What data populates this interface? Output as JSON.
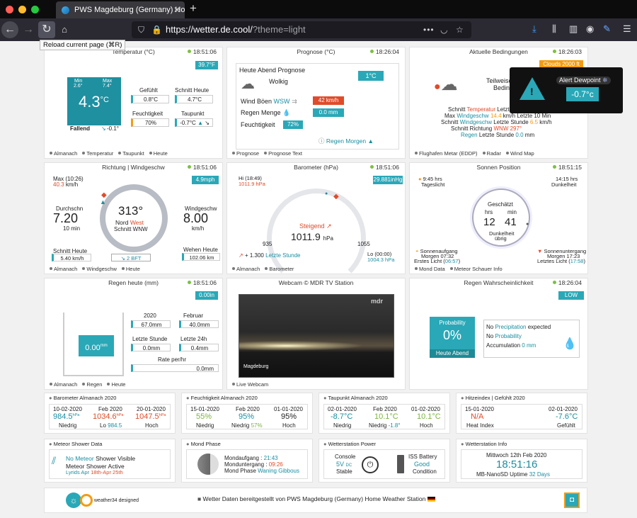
{
  "browser": {
    "tab_title": "PWS Magdeburg (Germany) Ho",
    "url_host": "https://wetter.de.cool/",
    "url_query": "?theme=light",
    "tooltip": "Reload current page (⌘R)"
  },
  "temp": {
    "title": "Temperatur (°C)",
    "time": "18:51:06",
    "badge": "39.7°F",
    "min_label": "Min",
    "min": "2.6°",
    "max_label": "Max",
    "max": "7.4°",
    "current": "4.3",
    "unit": "°C",
    "trend": "Fallend",
    "trend_val": "-0.1°",
    "feels_label": "Gefühlt",
    "feels": "0.8°C",
    "avg_label": "Schnitt Heute",
    "avg": "4.7°C",
    "hum_label": "Feuchtigkeit",
    "hum": "70%",
    "dew_label": "Taupunkt",
    "dew": "-0.7°C",
    "links": [
      "Almanach",
      "Temperatur",
      "Taupunkt",
      "Heute"
    ]
  },
  "forecast": {
    "title": "Prognose (°C)",
    "time": "18:26:04",
    "head": "Heute Abend Prognose",
    "cond": "Wolkig",
    "temp": "1°C",
    "wind_label": "Wind Böen",
    "wind_dir": "WSW",
    "wind_val": "42 km/h",
    "rain_label": "Regen Menge",
    "rain_val": "0.0 mm",
    "hum_label": "Feuchtigkeit",
    "hum_val": "72%",
    "rain_next": "Regen Morgen",
    "links": [
      "Prognose",
      "Prognose Text"
    ]
  },
  "cond": {
    "title": "Aktuelle Bedingungen",
    "time": "18:26:03",
    "badge": "Clouds 2000 ft",
    "teilw": "Teilweise",
    "bedin": "Bedin",
    "l1a": "Schnitt",
    "l1b": "Temperatur",
    "l1c": "Letzt",
    "l2a": "Max",
    "l2b": "Windgeschw",
    "l2c": "14.4",
    "l2d": "km/h",
    "l2e": "Letzte 10 Min",
    "l3a": "Schnitt",
    "l3b": "Windgeschw",
    "l3c": "Letzte Stunde",
    "l3d": "6.5",
    "l3e": "km/h",
    "l4a": "Schnitt Richtung",
    "l4b": "WNW 297°",
    "l5a": "Regen",
    "l5b": "Letzte Stunde",
    "l5c": "0.0",
    "l5d": "mm",
    "links": [
      "Flughafen Metar (EDDP)",
      "Radar",
      "Wind Map"
    ]
  },
  "alert": {
    "title": "Alert Dewpoint",
    "value": "-0.7°c"
  },
  "wind": {
    "title": "Richtung | Windgeschw",
    "time": "18:51:06",
    "badge": "4.9mph",
    "max_label": "Max (10:26)",
    "max_val": "40.3",
    "max_unit": "km/h",
    "avg_label": "Durchschn",
    "avg_val": "7.20",
    "avg_sub": "10 min",
    "deg": "313°",
    "dir1": "Nord",
    "dir2": "West",
    "dir_avg": "Schnitt WNW",
    "speed_label": "Windgeschw",
    "speed": "8.00",
    "speed_unit": "km/h",
    "today_label": "Schnitt Heute",
    "today": "5.40 km/h",
    "bft": "2 BFT",
    "gust_label": "Wehen Heute",
    "gust": "102.06 km",
    "links": [
      "Almanach",
      "Windgeschw",
      "Heute"
    ]
  },
  "baro": {
    "title": "Barometer (hPa)",
    "time": "18:51:06",
    "hi_label": "Hi (18:49)",
    "hi_val": "1011.9 hPa",
    "badge": "29.881inHg",
    "trend": "Steigend",
    "value": "1011.9",
    "unit": "hPa",
    "min": "935",
    "max": "1055",
    "change": "+ 1.300",
    "change_label": "Letzte Stunde",
    "lo_label": "Lo (00:00)",
    "lo_val": "1004.3 hPa",
    "links": [
      "Almanach",
      "Barometer"
    ]
  },
  "sun": {
    "title": "Sonnen Position",
    "time": "18:51:15",
    "day": "9:45 hrs",
    "day_label": "Tageslicht",
    "dark": "14:15 hrs",
    "dark_label": "Dunkelheit",
    "est": "Geschätzt",
    "hrs_label": "hrs",
    "min_label": "min",
    "hrs": "12",
    "min": "41",
    "remain1": "Dunkelheit",
    "remain2": "übrig",
    "rise_label": "Sonnenaufgang",
    "rise": "Morgen 07:32",
    "first_label": "Erstes Licht",
    "first": "06:57",
    "set_label": "Sonnenuntergang",
    "set": "Morgen 17:23",
    "last_label": "Letztes Licht",
    "last": "17:58",
    "links": [
      "Mond Data",
      "Meteor Schauer Info"
    ]
  },
  "rain": {
    "title": "Regen heute (mm)",
    "time": "18:51:06",
    "badge": "0.00in",
    "value": "0.00",
    "unit": "mm",
    "y_label": "2020",
    "y_val": "67.0mm",
    "m_label": "Februar",
    "m_val": "40.0mm",
    "h_label": "Letzte Stunde",
    "h_val": "0.0mm",
    "d_label": "Letzte 24h",
    "d_val": "0.4mm",
    "r_label": "Rate per/hr",
    "r_val": "0.0mm",
    "links": [
      "Almanach",
      "Regen",
      "Heute"
    ]
  },
  "webcam": {
    "title": "Webcam © MDR TV Station",
    "brand": "mdr",
    "caption": "Magdeburg",
    "links": [
      "Live Webcam"
    ]
  },
  "prob": {
    "title": "Regen Wahrscheinlichkeit",
    "time": "18:26:04",
    "badge": "LOW",
    "head": "Probability",
    "value": "0%",
    "sub": "Heute Abend",
    "l1a": "No",
    "l1b": "Precipitation",
    "l1c": "expected",
    "l2a": "No",
    "l2b": "Probability",
    "l3a": "Accumulation",
    "l3b": "0 mm"
  },
  "alm_baro": {
    "title": "Barometer Almanach 2020",
    "d1": "10-02-2020",
    "v1": "984.5",
    "u1": "hPa",
    "s1": "Niedrig",
    "d2": "Feb 2020",
    "v2": "1034.6",
    "u2": "hPa",
    "s2a": "Lo",
    "s2b": "984.5",
    "d3": "20-01-2020",
    "v3": "1047.5",
    "u3": "hPa",
    "s3": "Hoch"
  },
  "alm_hum": {
    "title": "Feuchtigkeit Almanach 2020",
    "d1": "15-01-2020",
    "v1": "55%",
    "s1": "Niedrig",
    "d2": "Feb 2020",
    "v2": "95%",
    "s2a": "Niedrig",
    "s2b": "57%",
    "d3": "01-01-2020",
    "v3": "95%",
    "s3": "Hoch"
  },
  "alm_dew": {
    "title": "Taupunkt Almanach 2020",
    "d1": "02-01-2020",
    "v1": "-8.7°C",
    "s1": "Niedrig",
    "d2": "Feb 2020",
    "v2": "10.1°C",
    "s2a": "Niedrig",
    "s2b": "-1.8°",
    "d3": "01-02-2020",
    "v3": "10.1°C",
    "s3": "Hoch"
  },
  "alm_heat": {
    "title": "Hitzeindex | Gefühlt 2020",
    "d1": "15-01-2020",
    "v1": "N/A",
    "s1": "Heat Index",
    "d3": "02-01-2020",
    "v3": "-7.6°C",
    "s3": "Gefühlt"
  },
  "meteor": {
    "title": "Meteor Shower Data",
    "l1a": "No Meteor",
    "l1b": "Shower Visible",
    "l2": "Meteor Shower Active",
    "l3a": "Lyrids",
    "l3b": "Apr",
    "l3c": "18th-Apr 25th"
  },
  "moon": {
    "title": "Mond Phase",
    "rise_label": "Mondaufgang :",
    "rise": "21:43",
    "set_label": "Monduntergang :",
    "set": "09:26",
    "phase_label": "Mond Phase",
    "phase": "Waning Gibbous"
  },
  "power": {
    "title": "Wetterstation Power",
    "console": "Console",
    "volt": "5V",
    "dc": "DC",
    "stable": "Stable",
    "iss": "ISS Battery",
    "good": "Good",
    "condition": "Condition"
  },
  "station": {
    "title": "Wetterstation Info",
    "date": "Mittwoch 12th Feb 2020",
    "clock": "18:51:16",
    "uptime_label": "MB-NanoSD Uptime",
    "uptime": "32 Days"
  },
  "footer": {
    "brand": "weather34 designed",
    "text": "Wetter Daten bereitgestellt von PWS Magdeburg (Germany) Home Weather Station"
  }
}
